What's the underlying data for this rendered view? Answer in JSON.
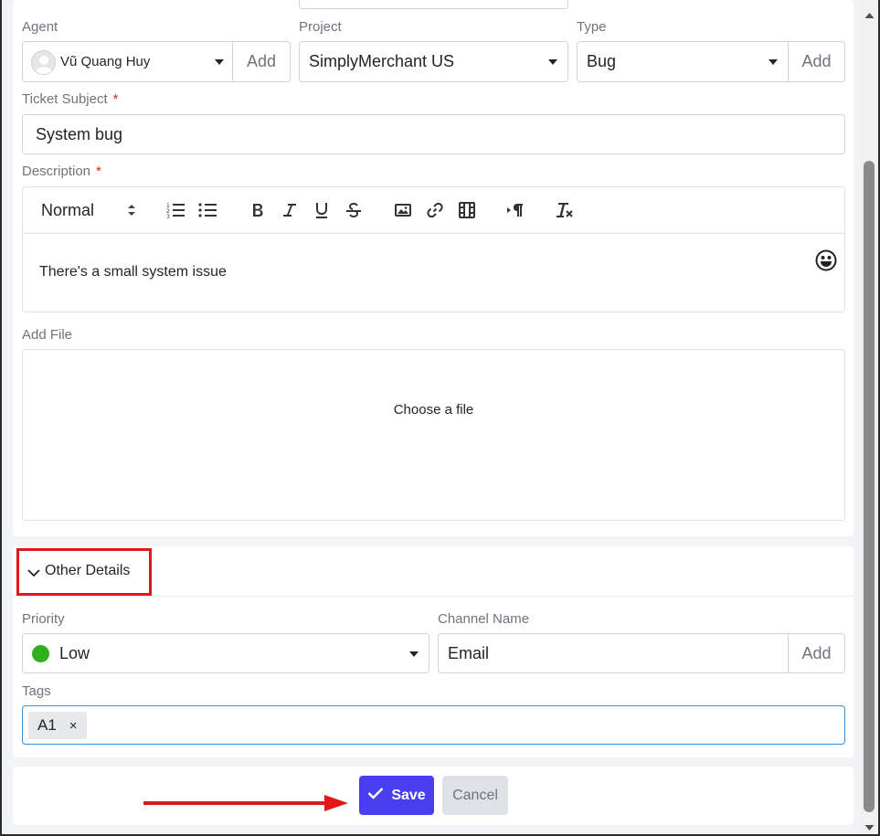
{
  "form": {
    "agent": {
      "label": "Agent",
      "value": "Vũ Quang Huy",
      "add_label": "Add"
    },
    "project": {
      "label": "Project",
      "value": "SimplyMerchant US"
    },
    "type": {
      "label": "Type",
      "value": "Bug",
      "add_label": "Add"
    },
    "subject": {
      "label": "Ticket Subject",
      "required_mark": "*",
      "value": "System bug"
    },
    "description": {
      "label": "Description",
      "required_mark": "*",
      "format_value": "Normal",
      "body_text": "There's a small system issue"
    },
    "add_file": {
      "label": "Add File",
      "prompt": "Choose a file"
    }
  },
  "other_details": {
    "header": "Other Details",
    "priority": {
      "label": "Priority",
      "value": "Low",
      "dot_color": "#2fb01c"
    },
    "channel": {
      "label": "Channel Name",
      "value": "Email",
      "add_label": "Add"
    },
    "tags": {
      "label": "Tags",
      "items": [
        {
          "text": "A1",
          "remove": "×"
        }
      ]
    }
  },
  "footer": {
    "save_label": "Save",
    "cancel_label": "Cancel"
  },
  "colors": {
    "primary": "#4a3ff0",
    "annotation_red": "#e01818",
    "required": "#e02424"
  }
}
